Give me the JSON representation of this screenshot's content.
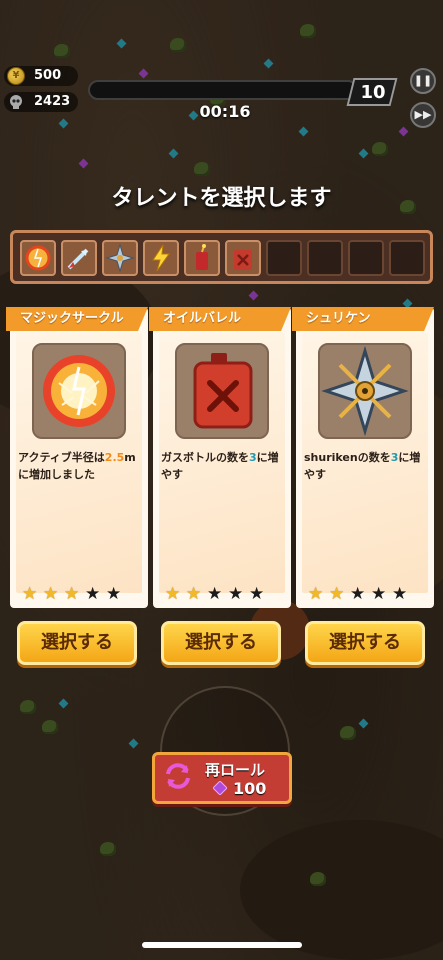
{
  "hud": {
    "coins": "500",
    "kills": "2423",
    "level": "10",
    "timer": "00:16",
    "xp_progress": 0.0
  },
  "title": "タレントを選択します",
  "owned_skills": [
    {
      "icon": "magic-circle-icon"
    },
    {
      "icon": "arrow-icon"
    },
    {
      "icon": "shuriken-icon"
    },
    {
      "icon": "lightning-icon"
    },
    {
      "icon": "firecracker-icon"
    },
    {
      "icon": "oil-barrel-icon"
    },
    {
      "icon": ""
    },
    {
      "icon": ""
    },
    {
      "icon": ""
    },
    {
      "icon": ""
    }
  ],
  "cards": [
    {
      "name": "マジックサークル",
      "icon": "magic-circle-icon",
      "desc_prefix": "アクティブ半径は",
      "desc_value": "2.5",
      "desc_mid": "m",
      "desc_suffix": "に増加しました",
      "stars_on": 3,
      "stars_total": 5,
      "button": "選択する"
    },
    {
      "name": "オイルバレル",
      "icon": "oil-barrel-icon",
      "desc_prefix": "ガスボトルの数を",
      "desc_value": "3",
      "desc_suffix": "に増やす",
      "stars_on": 2,
      "stars_total": 5,
      "button": "選択する"
    },
    {
      "name": "シュリケン",
      "icon": "shuriken-icon",
      "desc_prefix": "shurikenの数を",
      "desc_value": "3",
      "desc_suffix": "に増やす",
      "stars_on": 2,
      "stars_total": 5,
      "button": "選択する"
    }
  ],
  "reroll": {
    "label": "再ロール",
    "cost": "100"
  },
  "colors": {
    "ribbon": "#f29b2b",
    "button": "#f4a616",
    "reroll": "#c33d35",
    "highlight_orange": "#f28a1a",
    "highlight_teal": "#1f9bb4"
  }
}
